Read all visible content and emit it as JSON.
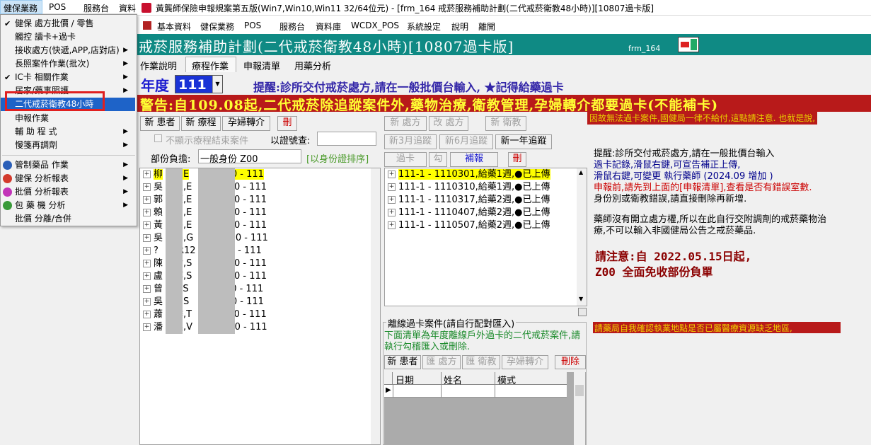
{
  "window": {
    "title": "黃龔師保險申報規案第五版(Win7,Win10,Win11 32/64位元) - [frm_164 戒菸服務補助計劃(二代戒菸衛教48小時)][10807過卡版]",
    "menubar": [
      "健保業務",
      "POS",
      "服務台",
      "資料",
      "基本資料",
      "健保業務",
      "POS",
      "服務台",
      "資料庫",
      "WCDX_POS",
      "系統設定",
      "說明",
      "離開"
    ]
  },
  "dropdown": {
    "items": [
      {
        "label": "健保 處方批價 / 零售",
        "check": true,
        "arrow": false
      },
      {
        "label": "觸控 讀卡+過卡",
        "check": false,
        "arrow": false
      },
      {
        "label": "接收處方(快遞,APP,店對店)",
        "check": false,
        "arrow": true
      },
      {
        "label": "長照案件作業(批次)",
        "check": false,
        "arrow": true
      },
      {
        "label": "IC卡 相關作業",
        "check": true,
        "arrow": true
      },
      {
        "label": "居家/藥事照護",
        "check": false,
        "arrow": true
      },
      {
        "label": "二代戒菸衛教48小時",
        "check": false,
        "arrow": false
      },
      {
        "label": "申報作業",
        "check": false,
        "arrow": false
      },
      {
        "label": "輔 助 程 式",
        "check": false,
        "arrow": true
      },
      {
        "label": "慢箋再調劑",
        "check": false,
        "arrow": true
      },
      {
        "label": "管制藥品 作業",
        "icon": "#2b5fb8",
        "arrow": true
      },
      {
        "label": "健保 分析報表",
        "icon": "#d33a2c",
        "arrow": true
      },
      {
        "label": "批價 分析報表",
        "icon": "#c234b8",
        "arrow": true
      },
      {
        "label": "包 藥 機 分析",
        "icon": "#3a9a3a",
        "arrow": true
      },
      {
        "label": "批價 分離/合併",
        "check": false,
        "arrow": false
      }
    ]
  },
  "form": {
    "header_title": "戒菸服務補助計劃(二代戒菸衛教48小時)[10807過卡版]",
    "frm_code": "frm_164",
    "tabs": [
      "作業說明",
      "療程作業",
      "申報清單",
      "用藥分析"
    ],
    "year_label": "年度",
    "year_value": "111",
    "reminder": "提醒:診所交付戒菸處方,請在一般批價台輸入, ★記得給藥過卡",
    "warning": "警告:自109.08起,二代戒菸除追蹤案件外,藥物治療,衛教管理,孕婦轉介都要過卡(不能補卡)",
    "warning_sub": "因故無法過卡案件,國健局一律不給付,這點請注意. 也就是說,",
    "buttons_left": [
      "新 患者",
      "新 療程",
      "孕婦轉介",
      "刪"
    ],
    "hide_finished": "不顯示療程結束案件",
    "id_search_label": "以證號查:",
    "id_search_value": "",
    "copay_label": "部份負擔:",
    "copay_value": "一般身份 Z00",
    "sort_hint": "[以身份證排序]",
    "patients": [
      {
        "name": "柳",
        "mid": "Z,E",
        "tail": "5 Z00 - 111"
      },
      {
        "name": "吳",
        "mid": "豈,E",
        "tail": "0 Z00 - 111"
      },
      {
        "name": "郭",
        "mid": "蕉,E",
        "tail": "8 Z00 - 111"
      },
      {
        "name": "賴",
        "mid": "月,E",
        "tail": "7 Z00 - 111"
      },
      {
        "name": "黃",
        "mid": "暑,E",
        "tail": "0 Z00 - 111"
      },
      {
        "name": "吳",
        "mid": "害,G",
        "tail": "8 Z00 - 111"
      },
      {
        "name": "?",
        "mid": "?,R12",
        "tail": "Z00 - 111"
      },
      {
        "name": "陳",
        "mid": "俞,S",
        "tail": "2 Z00 - 111"
      },
      {
        "name": "盧",
        "mid": "萍,S",
        "tail": "7 Z00 - 111"
      },
      {
        "name": "曾",
        "mid": "E,S",
        "tail": "0 Z00 - 111"
      },
      {
        "name": "吳",
        "mid": "Z,S",
        "tail": "3 Z00 - 111"
      },
      {
        "name": "蕭",
        "mid": "季,T",
        "tail": "0 Z00 - 111"
      },
      {
        "name": "潘",
        "mid": "集,V",
        "tail": "8 Z00 - 111"
      }
    ],
    "buttons_mid_row1": [
      "新 處方",
      "改 處方",
      "新 衛教"
    ],
    "buttons_mid_row2": [
      "新3月追蹤",
      "新6月追蹤",
      "新一年追蹤"
    ],
    "buttons_mid_row3": [
      "過卡",
      "勾",
      "補報",
      "刪"
    ],
    "records": [
      "111-1 - 1110301,給藥1週,●已上傳",
      "111-1 - 1110310,給藥1週,●已上傳",
      "111-1 - 1110317,給藥2週,●已上傳",
      "111-1 - 1110407,給藥2週,●已上傳",
      "111-1 - 1110507,給藥2週,●已上傳"
    ],
    "offline_title": "離線過卡案件(請自行配對匯入)",
    "offline_desc": "下面清單為年度離線戶外過卡的二代戒菸案件,請執行勾稽匯入或刪除.",
    "offline_buttons": [
      "新 患者",
      "匯 處方",
      "匯 衛教",
      "孕婦轉介",
      "刪除"
    ],
    "offline_cols": [
      "日期",
      "姓名",
      "模式"
    ],
    "info_lines": [
      {
        "text": "提醒:診所交付戒菸處方,請在一般批價台輸入",
        "color": "#000000"
      },
      {
        "text": "過卡記錄,滑鼠右鍵,可宣告補正上傳,",
        "color": "#00008b"
      },
      {
        "text": "滑鼠右鍵,可變更 執行藥師 (2024.09 增加 )",
        "color": "#00008b"
      },
      {
        "text": "申報前,請先到上面的[申報清單],查看是否有錯誤室數.",
        "color": "#cc0000"
      },
      {
        "text": "身份別或衛教錯誤,請直接刪除再新增.",
        "color": "#000000"
      }
    ],
    "info_para": "藥師沒有開立處方權,所以在此自行交附調劑的戒菸藥物治療,不可以輸入非國健局公告之戒菸藥品.",
    "notice_line1": "請注意:自 2022.05.15日起,",
    "notice_line2": "Z00 全面免收部份負單",
    "bottom_banner": "請藥局自我確認執業地點是否已屬醫療資源缺乏地區,"
  }
}
